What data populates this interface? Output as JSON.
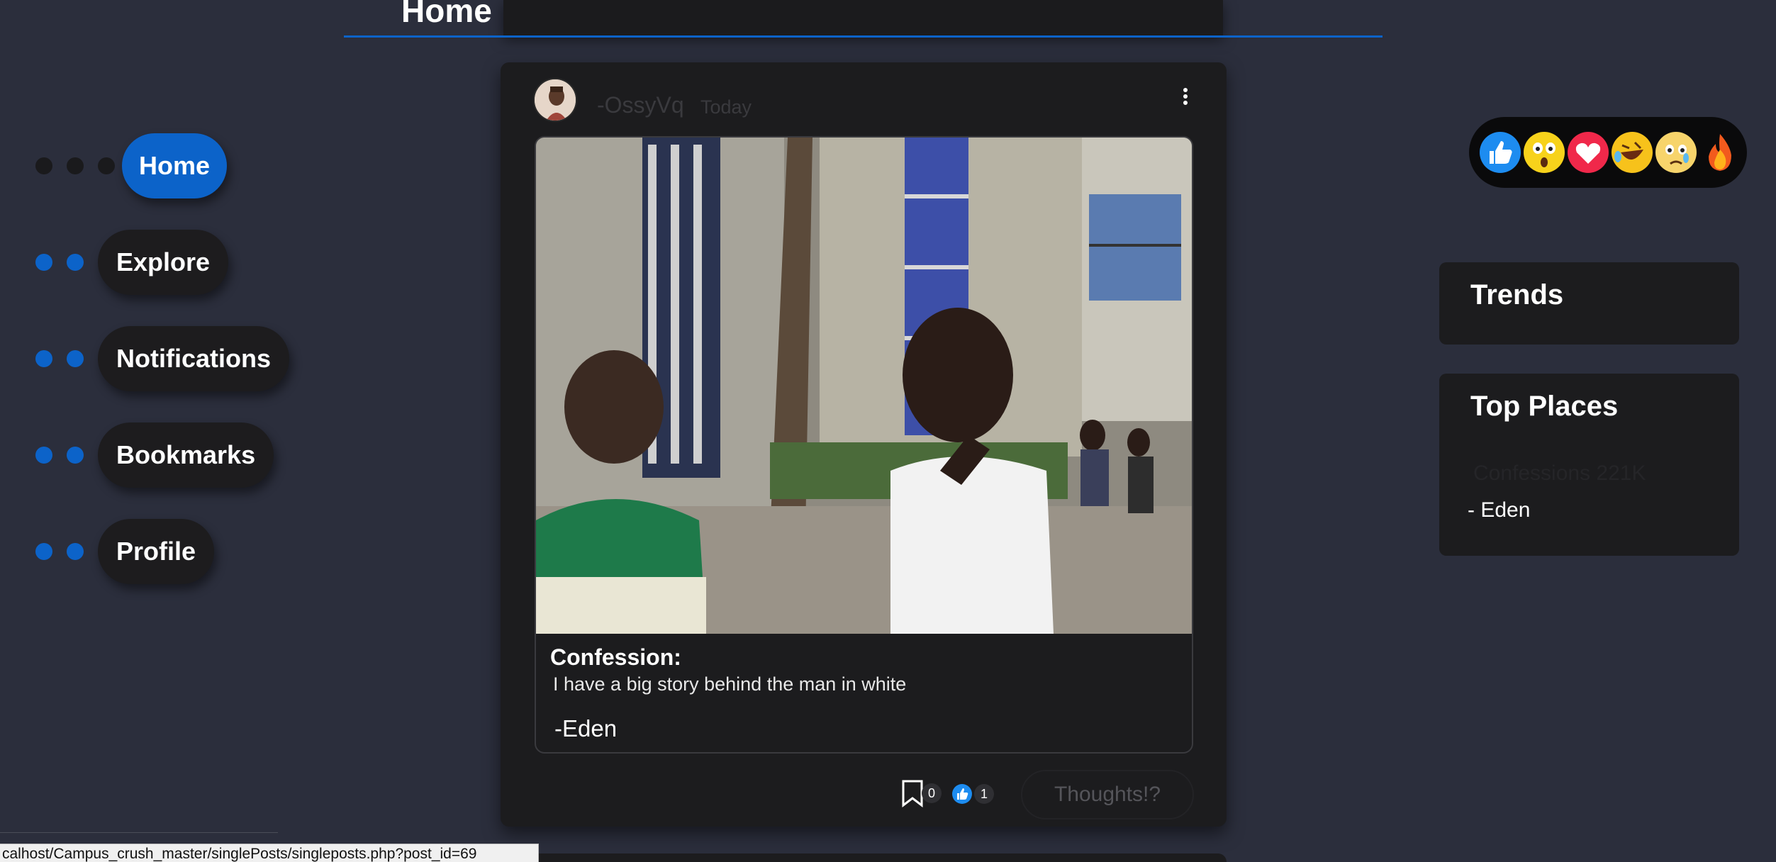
{
  "header": {
    "title": "Home"
  },
  "nav": {
    "items": [
      {
        "label": "Home",
        "active": true
      },
      {
        "label": "Explore",
        "active": false
      },
      {
        "label": "Notifications",
        "active": false
      },
      {
        "label": "Bookmarks",
        "active": false
      },
      {
        "label": "Profile",
        "active": false
      }
    ]
  },
  "post": {
    "username": "-OssyVq",
    "time": "Today",
    "confession_label": "Confession:",
    "confession_text": "I have a big story behind the man in white",
    "signature": "-Eden",
    "bookmark_count": "0",
    "like_count": "1",
    "thoughts_label": "Thoughts!?"
  },
  "reactions": [
    "like",
    "wow",
    "love",
    "laugh",
    "sad",
    "fire"
  ],
  "trends": {
    "title": "Trends"
  },
  "top_places": {
    "title": "Top Places",
    "faded_item": "Confessions 221K",
    "items": [
      "- Eden"
    ]
  },
  "status_bar": {
    "url": "calhost/Campus_crush_master/singlePosts/singleposts.php?post_id=69"
  },
  "colors": {
    "background": "#2b2e3c",
    "accent": "#0c63c9",
    "card": "#1c1c1e"
  }
}
